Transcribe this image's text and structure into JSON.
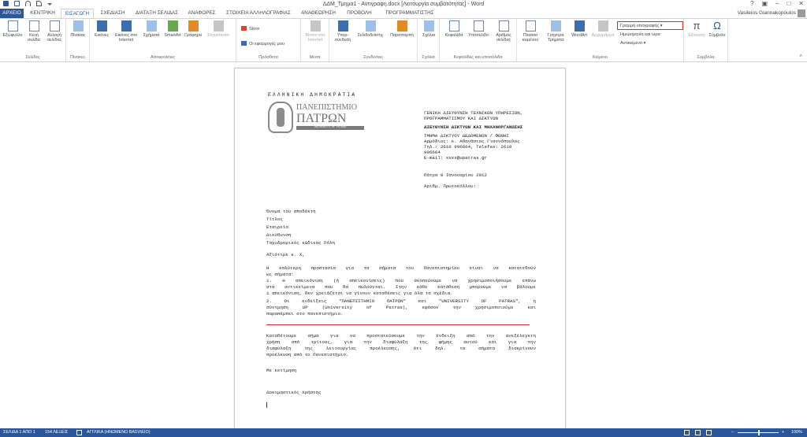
{
  "window": {
    "title": "ΔΔΜ_Τμημα1 - Αντιγραφη.docx [Λειτουργία συμβατότητας] - Word",
    "controls": [
      "?",
      "▣",
      "–",
      "□",
      "✕"
    ]
  },
  "qat": {
    "icons": [
      "word-icon",
      "save-icon",
      "undo-icon",
      "redo-icon",
      "customize-icon"
    ]
  },
  "tabs": [
    {
      "label": "ΑΡΧΕΙΟ"
    },
    {
      "label": "ΚΕΝΤΡΙΚΗ"
    },
    {
      "label": "ΕΙΣΑΓΩΓΗ"
    },
    {
      "label": "ΣΧΕΔΙΑΣΗ"
    },
    {
      "label": "ΔΙΑΤΑΞΗ ΣΕΛΙΔΑΣ"
    },
    {
      "label": "ΑΝΑΦΟΡΕΣ"
    },
    {
      "label": "ΣΤΟΙΧΕΙΑ ΑΛΛΗΛΟΓΡΑΦΙΑΣ"
    },
    {
      "label": "ΑΝΑΘΕΩΡΗΣΗ"
    },
    {
      "label": "ΠΡΟΒΟΛΗ"
    },
    {
      "label": "ΠΡΟΓΡΑΜΜΑΤΙΣΤΗΣ"
    }
  ],
  "user": {
    "name": "Vasileios Giannakopoulos"
  },
  "ribbon": {
    "groups": {
      "pages": {
        "label": "Σελίδες",
        "buttons": [
          "Εξώφυλλο",
          "Κενή σελίδα",
          "Αλλαγή σελίδας"
        ]
      },
      "tables": {
        "label": "Πίνακες",
        "buttons": [
          "Πίνακας"
        ]
      },
      "illustrations": {
        "label": "Απεικονίσεις",
        "buttons": [
          "Εικόνες",
          "Εικόνες στο Internet",
          "Σχήματα",
          "SmartArt",
          "Γράφημα",
          "Στιγμιότυπο"
        ]
      },
      "addins": {
        "label": "Πρόσθετα",
        "buttons": [
          "Store",
          "Οι εφαρμογές μου"
        ]
      },
      "media": {
        "label": "Μέσα",
        "buttons": [
          "Βίντεο στο Internet"
        ]
      },
      "links": {
        "label": "Συνδέσεις",
        "buttons": [
          "Υπερ-σύνδεση",
          "Σελιδοδείκτης",
          "Παραπομπή"
        ]
      },
      "comments": {
        "label": "Σχόλια",
        "buttons": [
          "Σχόλια"
        ]
      },
      "header_footer": {
        "label": "Κεφαλίδες και υποσέλιδα",
        "buttons": [
          "Κεφαλίδα",
          "Υποσέλιδο",
          "Αριθμός σελίδας"
        ]
      },
      "text": {
        "label": "Κείμενο",
        "buttons": [
          "Πλαίσιο κειμένου",
          "Γρήγορα Τμήματα",
          "WordArt",
          "Αρχιγράμμα"
        ],
        "side": [
          "Γραμμή υπογραφής",
          "Ημερομηνία και ώρα",
          "Αντικείμενο"
        ]
      },
      "symbols": {
        "label": "Σύμβολα",
        "buttons": [
          "Εξίσωση",
          "Σύμβολο"
        ]
      }
    }
  },
  "document": {
    "header_line": "ΕΛΛΗΝΙΚΗ ΔΗΜΟΚΡΑΤΙΑ",
    "logo": {
      "line1": "ΠΑΝΕΠΙΣΤΗΜΙΟ",
      "line2": "ΠΑΤΡΩΝ",
      "line3": "UNIVERSITY OF PATRAS"
    },
    "right_block": [
      "ΓΕΝΙΚΗ ΔΙΕΥΘΥΝΣΗ ΤΕΧΝΙΚΩΝ ΥΠΗΡΕΣΙΩΝ,",
      "ΠΡΟΓΡΑΜΜΑΤΙΣΜΟΥ ΚΑΙ ΔΙΚΤΥΩΝ",
      "ΔΙΕΥΘΥΝΣΗ ΔΙΚΤΥΩΝ ΚΑΙ ΜΗΧΑΝΟΡΓΑΝΩΣΗΣ",
      "ΤΜΗΜΑ ΔΙΚΤΥΟΥ ΔΕΔΟΜΕΝΩΝ / ΦΩΝΗΣ",
      "Αρμόδιος: κ. Αθανάσιος Γιαννόπουλος",
      "Τηλ.: 2610 996664, Telefax: 2610",
      "996664",
      "E-mail: xxxx@upatras.gr",
      "Πάτρα 9 Ιανουαρίου 2012",
      "Αριθμ. Πρωτοκόλλου:"
    ],
    "address_block": [
      "Όνομα του αποδέκτη",
      "Τίτλος",
      "Εταιρεία",
      "Διεύθυνση",
      "Ταχυδρομικός κώδικας Πόλη"
    ],
    "salutation": "Αξιότιμε κ. Χ,",
    "body": [
      "Η καλύτερη προστασία για τα σήματα του Πανεπιστημίου είναι να κατατεθούν",
      "ως σήματα:",
      "1. Η απεικόνιση (ή απεικονίσεις) που σκοπεύουμε να χρησιμοποιήσουμε επάνω",
      "στα αντικείμενα που θα πωλούνται. Στην κάθε κατάθεση μπορούμε να βάλουμε",
      "1 απεικόνιση, δεν χρειάζεται να γίνουν καταθέσεις για όλα τα σχέδια.",
      "2. Οι ενδείξεις \"ΠΑΝΕΠΙΣΤΗΜΙΟ ΠΑΤΡΩΝ\" και \"UNIVERSITY OF PATRAS\", η",
      "σύντμηση UP (University of Patras), εφόσον την χρησιμοποιούμε και",
      "παραπέμπει στο πανεπιστήμιο."
    ],
    "body2": [
      "Καταθέτουμε σήμα για να προστατεύσουμε την ένδειξη από την ανεξέλεγκτη",
      "χρήση από τρίτους, για την διαφύλαξη της φήμης αυτού και για την",
      "διαφύλαξη της λειτουργίας προέλευσης, ότι δηλ. τα σήματα διακρίνουν",
      "προέλευση από το Πανεπιστήμιο."
    ],
    "closing": "Με εκτίμηση",
    "signature": "Δοκιμαστικός Χρήστης"
  },
  "status": {
    "page": "ΣΕΛΙΔΑ 1 ΑΠΟ 1",
    "words": "154 ΛΕΞΕΙΣ",
    "language": "ΑΓΓΛΙΚΑ (ΗΝΩΜΕΝΟ ΒΑΣΙΛΕΙΟ)",
    "zoom": "100%",
    "zoom_minus": "–",
    "zoom_plus": "+"
  },
  "colors": {
    "accent": "#2b579a",
    "highlight": "#d62b2b"
  }
}
